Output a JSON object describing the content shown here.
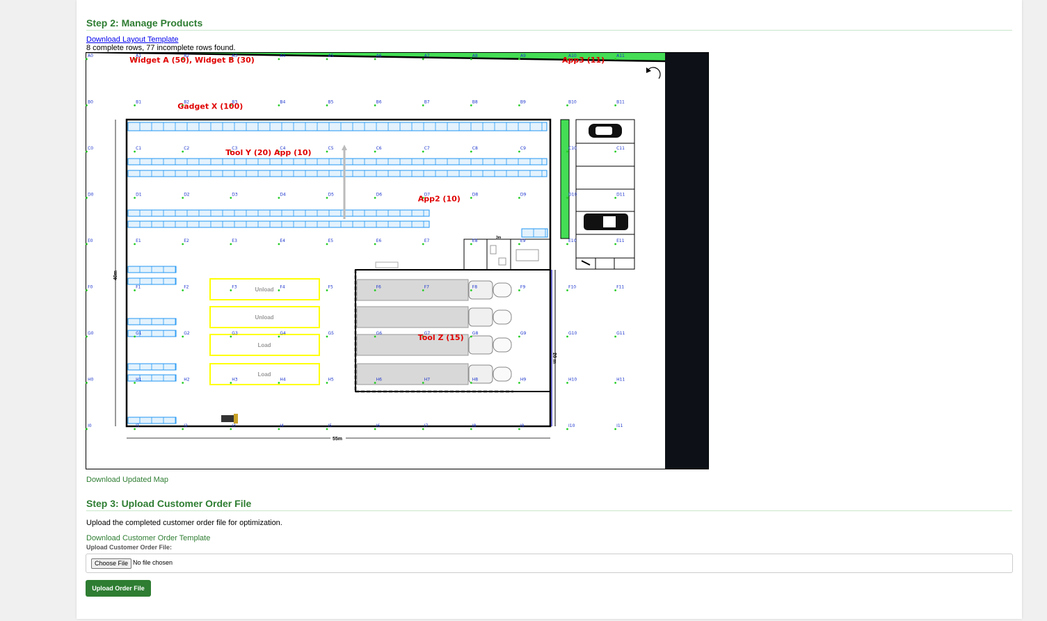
{
  "step2": {
    "title": "Step 2: Manage Products",
    "download_template": "Download Layout Template",
    "rows_status": "8 complete rows, 77 incomplete rows found.",
    "download_map": "Download Updated Map"
  },
  "map": {
    "rows": [
      "A",
      "B",
      "C",
      "D",
      "E",
      "F",
      "G",
      "H",
      "I",
      "J"
    ],
    "cols": 12,
    "products": [
      {
        "cell": "A1",
        "text": "Widget A (50), Widget B (30)"
      },
      {
        "cell": "A10",
        "text": "App3 (11)"
      },
      {
        "cell": "B2",
        "text": "Gadget X (100)"
      },
      {
        "cell": "C3",
        "text": "Tool Y (20)  App (10)"
      },
      {
        "cell": "D7",
        "text": "App2 (10)"
      },
      {
        "cell": "G7",
        "text": "Tool Z (15)"
      }
    ],
    "zones": [
      "Unload",
      "Unload",
      "Load",
      "Load"
    ],
    "dim_width": "55m",
    "dim_height": "40m",
    "dim_dock": "20 m",
    "colors": {
      "wall": "#000000",
      "rack": "#2196f3",
      "dot": "#22cc22",
      "grid_text": "#1a33cc",
      "product": "#e00000",
      "green_bar": "#44dd55",
      "dark_strip": "#0d1117",
      "zone_border": "#ffff00"
    }
  },
  "step3": {
    "title": "Step 3: Upload Customer Order File",
    "desc": "Upload the completed customer order file for optimization.",
    "download_template": "Download Customer Order Template",
    "file_label": "Upload Customer Order File:",
    "choose_label": "Choose File",
    "no_file": "No file chosen",
    "upload_button": "Upload Order File"
  }
}
